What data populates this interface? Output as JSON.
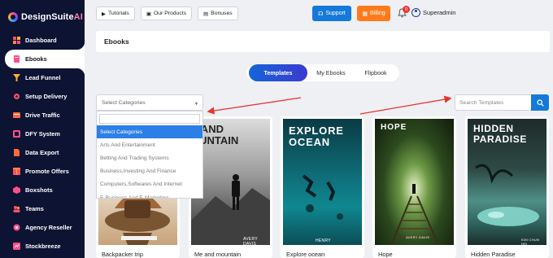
{
  "app": {
    "brand_main": "DesignSuite",
    "brand_ai": "AI"
  },
  "sidebar": {
    "items": [
      {
        "label": "Dashboard",
        "icon": "dashboard-icon",
        "color": "#ff4f6d",
        "active": false
      },
      {
        "label": "Ebooks",
        "icon": "ebook-icon",
        "color": "#ff4f8b",
        "active": true
      },
      {
        "label": "Lead Funnel",
        "icon": "funnel-icon",
        "color": "#ffb02e",
        "active": false
      },
      {
        "label": "Setup Delivery",
        "icon": "gear-icon",
        "color": "#ff4f6d",
        "active": false
      },
      {
        "label": "Drive Traffic",
        "icon": "traffic-icon",
        "color": "#ff6a3d",
        "active": false
      },
      {
        "label": "DFY System",
        "icon": "system-icon",
        "color": "#ff4f8b",
        "active": false
      },
      {
        "label": "Data Export",
        "icon": "export-icon",
        "color": "#ff6a3d",
        "active": false
      },
      {
        "label": "Promote Offers",
        "icon": "offer-icon",
        "color": "#ff4f6d",
        "active": false
      },
      {
        "label": "Boxshots",
        "icon": "box-icon",
        "color": "#ff4f8b",
        "active": false
      },
      {
        "label": "Teams",
        "icon": "team-icon",
        "color": "#ff4f6d",
        "active": false
      },
      {
        "label": "Agency Reseller",
        "icon": "reseller-icon",
        "color": "#ff4f8b",
        "active": false
      },
      {
        "label": "Stockbreeze",
        "icon": "stock-icon",
        "color": "#ff4f8b",
        "active": false
      }
    ]
  },
  "topbar": {
    "tutorials": "Tutorials",
    "our_products": "Our Products",
    "bonuses": "Bonuses",
    "support": "Support",
    "billing": "Billing",
    "notification_count": "0",
    "username": "Superadmin"
  },
  "page": {
    "title": "Ebooks"
  },
  "tabs": [
    {
      "label": "Templates",
      "active": true
    },
    {
      "label": "My Ebooks",
      "active": false
    },
    {
      "label": "Flipbook",
      "active": false
    }
  ],
  "category_select": {
    "value": "Select Categories",
    "options": [
      "Select Categories",
      "Arts And Entertainment",
      "Betting And Trading Systems",
      "Business,Investing And Finance",
      "Computers,Softwares And Internet",
      "E-Business And E-Marketing"
    ],
    "selected_index": 0
  },
  "search": {
    "placeholder": "Search Templates"
  },
  "templates": [
    {
      "name": "Backpacker trip",
      "cover_title": "",
      "author": ""
    },
    {
      "name": "Me and mountain",
      "cover_title": "E AND\nOUNTAIN",
      "author": "AVERY DAVIS"
    },
    {
      "name": "Explore ocean",
      "cover_title": "EXPLORE\nOCEAN",
      "author": "HENRY"
    },
    {
      "name": "Hope",
      "cover_title": "HOPE",
      "author": "AVERY DAVIS"
    },
    {
      "name": "Hidden Paradise",
      "cover_title": "HIDDEN\nPARADISE",
      "author": "KIM CHUN HEI"
    }
  ],
  "colors": {
    "sidebar_bg": "#0d1333",
    "primary": "#1479d9",
    "billing": "#ff7a1a",
    "annotation_arrow": "#e8332a"
  }
}
